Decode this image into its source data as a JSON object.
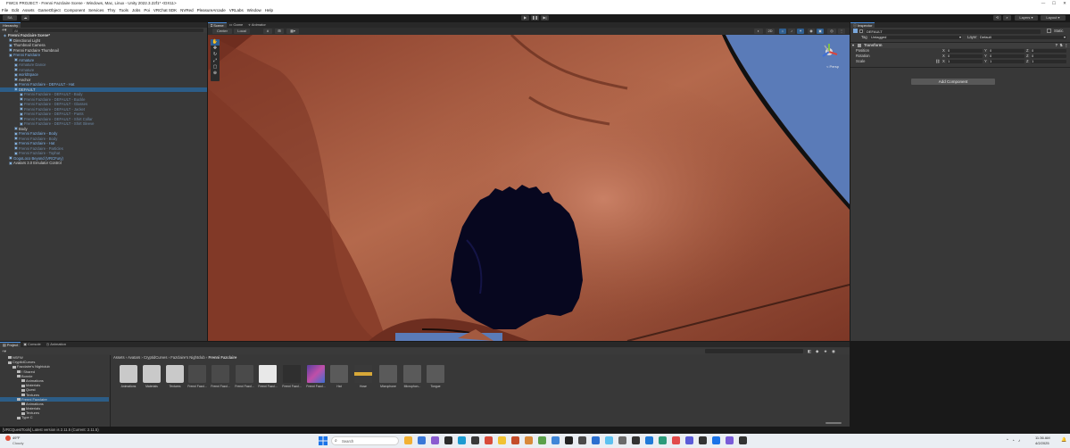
{
  "window": {
    "title": "FWCS PROJECT - Frenni Fazclaire Scene - Windows, Mac, Linux - Unity 2022.3.22f1* <DX11>",
    "controls": [
      "—",
      "☐",
      "✕"
    ]
  },
  "menu": [
    "File",
    "Edit",
    "Assets",
    "GameObject",
    "Component",
    "Services",
    "Thry",
    "Tools",
    "Jobs",
    "Poi",
    "VRChat SDK",
    "NVRed",
    "PleasureArcade",
    "VRLabs",
    "Window",
    "Help"
  ],
  "toolbar": {
    "account": "SA",
    "layers_label": "Layers",
    "layout_label": "Layout",
    "play_icons": [
      "play-icon",
      "pause-icon",
      "step-icon"
    ]
  },
  "hierarchy": {
    "tab_label": "Hierarchy",
    "search_placeholder": "All",
    "rows": [
      {
        "label": "Frenni Fazclaire Scene*",
        "indent": 0,
        "style": "scene"
      },
      {
        "label": "Directional Light",
        "indent": 1,
        "style": "normal"
      },
      {
        "label": "Thumbnail Camera",
        "indent": 1,
        "style": "normal"
      },
      {
        "label": "Frenni Fazclaire Thumbnail",
        "indent": 1,
        "style": "normal"
      },
      {
        "label": "Frenni Fazclaire",
        "indent": 1,
        "style": "prefab"
      },
      {
        "label": "Armature",
        "indent": 2,
        "style": "prefab"
      },
      {
        "label": "Armature Dance",
        "indent": 2,
        "style": "dim"
      },
      {
        "label": "Armature",
        "indent": 2,
        "style": "dim"
      },
      {
        "label": "worldSpace",
        "indent": 2,
        "style": "prefab"
      },
      {
        "label": "Anchor",
        "indent": 2,
        "style": "normal"
      },
      {
        "label": "Frenni Fazclaire - DEFAULT - Hat",
        "indent": 2,
        "style": "prefab"
      },
      {
        "label": "DEFAULT",
        "indent": 2,
        "style": "sel"
      },
      {
        "label": "Frenni Fazclaire - DEFAULT - Body",
        "indent": 3,
        "style": "dim"
      },
      {
        "label": "Frenni Fazclaire - DEFAULT - Buckle",
        "indent": 3,
        "style": "dim"
      },
      {
        "label": "Frenni Fazclaire - DEFAULT - Glasses",
        "indent": 3,
        "style": "dim"
      },
      {
        "label": "Frenni Fazclaire - DEFAULT - Jacket",
        "indent": 3,
        "style": "dim"
      },
      {
        "label": "Frenni Fazclaire - DEFAULT - Pants",
        "indent": 3,
        "style": "dim"
      },
      {
        "label": "Frenni Fazclaire - DEFAULT - Shirt Collar",
        "indent": 3,
        "style": "dim"
      },
      {
        "label": "Frenni Fazclaire - DEFAULT - Shirt Sleeve",
        "indent": 3,
        "style": "dim"
      },
      {
        "label": "Body",
        "indent": 2,
        "style": "normal"
      },
      {
        "label": "Frenni Fazclaire - Body",
        "indent": 2,
        "style": "prefab"
      },
      {
        "label": "Frenni Fazclaire - Body",
        "indent": 2,
        "style": "dim"
      },
      {
        "label": "Frenni Fazclaire - Hat",
        "indent": 2,
        "style": "prefab"
      },
      {
        "label": "Frenni Fazclaire - Particles",
        "indent": 2,
        "style": "dim"
      },
      {
        "label": "Frenni Fazclaire - Tophat",
        "indent": 2,
        "style": "dim"
      },
      {
        "label": "GogoLoco Beyond (VRCFury)",
        "indent": 1,
        "style": "prefab"
      },
      {
        "label": "Avatars 3.0 Emulator Control",
        "indent": 1,
        "style": "normal"
      }
    ]
  },
  "scene": {
    "tabs": [
      "Scene",
      "Game",
      "Animator"
    ],
    "active_tab": "Scene",
    "shading": "Center",
    "pivot": "Local",
    "persp_label": "< Persp"
  },
  "inspector": {
    "tab_label": "Inspector",
    "object_name": "DEFAULT",
    "static_label": "Static",
    "tag_label": "Tag",
    "tag_value": "Untagged",
    "layer_label": "Layer",
    "layer_value": "Default",
    "component_title": "Transform",
    "position": {
      "label": "Position",
      "x": "0",
      "y": "0",
      "z": "0"
    },
    "rotation": {
      "label": "Rotation",
      "x": "0",
      "y": "0",
      "z": "0"
    },
    "scale": {
      "label": "Scale",
      "x": "1",
      "y": "1",
      "z": "1"
    },
    "add_component": "Add Component"
  },
  "project": {
    "tabs": [
      "Project",
      "Console",
      "Animation"
    ],
    "breadcrumb": [
      "Assets",
      "Avatars",
      "CryptidCurves",
      "Fazclaire's Nightclub",
      "Frenni Fazclaire"
    ],
    "tree": [
      {
        "label": "NSFW",
        "indent": 1,
        "sel": false
      },
      {
        "label": "CryptidCurves",
        "indent": 1,
        "sel": false
      },
      {
        "label": "Fazclaire's Nightclub",
        "indent": 2,
        "sel": false
      },
      {
        "label": "! Shared",
        "indent": 3,
        "sel": false
      },
      {
        "label": "Bonnie",
        "indent": 3,
        "sel": false
      },
      {
        "label": "Animations",
        "indent": 4,
        "sel": false
      },
      {
        "label": "Materials",
        "indent": 4,
        "sel": false
      },
      {
        "label": "Quest",
        "indent": 4,
        "sel": false
      },
      {
        "label": "Textures",
        "indent": 4,
        "sel": false
      },
      {
        "label": "Frenni Fazclaire",
        "indent": 3,
        "sel": true
      },
      {
        "label": "Animations",
        "indent": 4,
        "sel": false
      },
      {
        "label": "Materials",
        "indent": 4,
        "sel": false
      },
      {
        "label": "Textures",
        "indent": 4,
        "sel": false
      },
      {
        "label": "Type C",
        "indent": 3,
        "sel": false
      }
    ],
    "assets": [
      {
        "label": "Animations",
        "kind": "folder"
      },
      {
        "label": "Materials",
        "kind": "folder"
      },
      {
        "label": "Textures",
        "kind": "folder"
      },
      {
        "label": "Frenni Fazcl...",
        "kind": "model"
      },
      {
        "label": "Frenni Fazcl...",
        "kind": "model"
      },
      {
        "label": "Frenni Fazcl...",
        "kind": "model"
      },
      {
        "label": "Frenni Fazcl...",
        "kind": "file"
      },
      {
        "label": "Frenni Fazcl...",
        "kind": "unity"
      },
      {
        "label": "Frenni Fazcl...",
        "kind": "image"
      },
      {
        "label": "Hat",
        "kind": "mesh"
      },
      {
        "label": "Hose",
        "kind": "hose"
      },
      {
        "label": "Microphone",
        "kind": "mic"
      },
      {
        "label": "Microphon...",
        "kind": "mic"
      },
      {
        "label": "Tongue",
        "kind": "tongue"
      }
    ]
  },
  "status": {
    "message": "[VRCQuestTools] Latest version is 2.11.5 (Current: 2.11.5)"
  },
  "taskbar": {
    "weather_temp": "49°F",
    "weather_desc": "Cloudy",
    "search_placeholder": "Search",
    "time": "11:36 AM",
    "date": "4/2/2025"
  },
  "colors": {
    "skin": "#a0543a",
    "sky": "#5a7bb8",
    "selection": "#2c5d87",
    "panel": "#383838"
  }
}
